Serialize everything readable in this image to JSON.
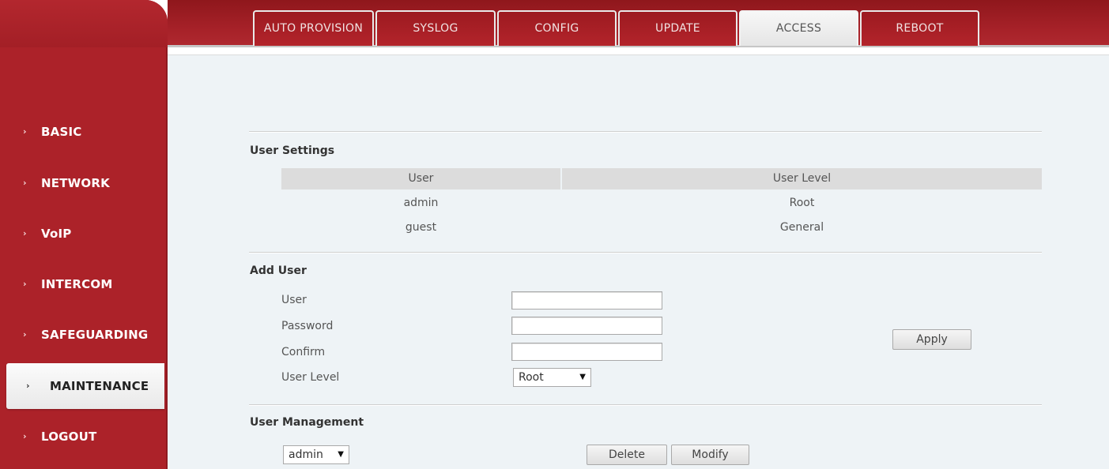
{
  "tabs": [
    {
      "label": "AUTO PROVISION"
    },
    {
      "label": "SYSLOG"
    },
    {
      "label": "CONFIG"
    },
    {
      "label": "UPDATE"
    },
    {
      "label": "ACCESS"
    },
    {
      "label": "REBOOT"
    }
  ],
  "sidebar": {
    "items": [
      {
        "label": "BASIC"
      },
      {
        "label": "NETWORK"
      },
      {
        "label": "VoIP"
      },
      {
        "label": "INTERCOM"
      },
      {
        "label": "SAFEGUARDING"
      },
      {
        "label": "MAINTENANCE"
      },
      {
        "label": "LOGOUT"
      }
    ],
    "chevron": "›"
  },
  "user_settings": {
    "title": "User Settings",
    "columns": [
      "User",
      "User Level"
    ],
    "rows": [
      [
        "admin",
        "Root"
      ],
      [
        "guest",
        "General"
      ]
    ]
  },
  "add_user": {
    "title": "Add User",
    "fields": {
      "user": {
        "label": "User",
        "value": ""
      },
      "password": {
        "label": "Password",
        "value": ""
      },
      "confirm": {
        "label": "Confirm",
        "value": ""
      },
      "user_level": {
        "label": "User Level",
        "value": "Root"
      }
    },
    "apply_label": "Apply"
  },
  "user_management": {
    "title": "User Management",
    "selected_user": "admin",
    "delete_label": "Delete",
    "modify_label": "Modify"
  },
  "colors": {
    "brand_red": "#ac2229",
    "content_bg": "#eef3f6"
  }
}
